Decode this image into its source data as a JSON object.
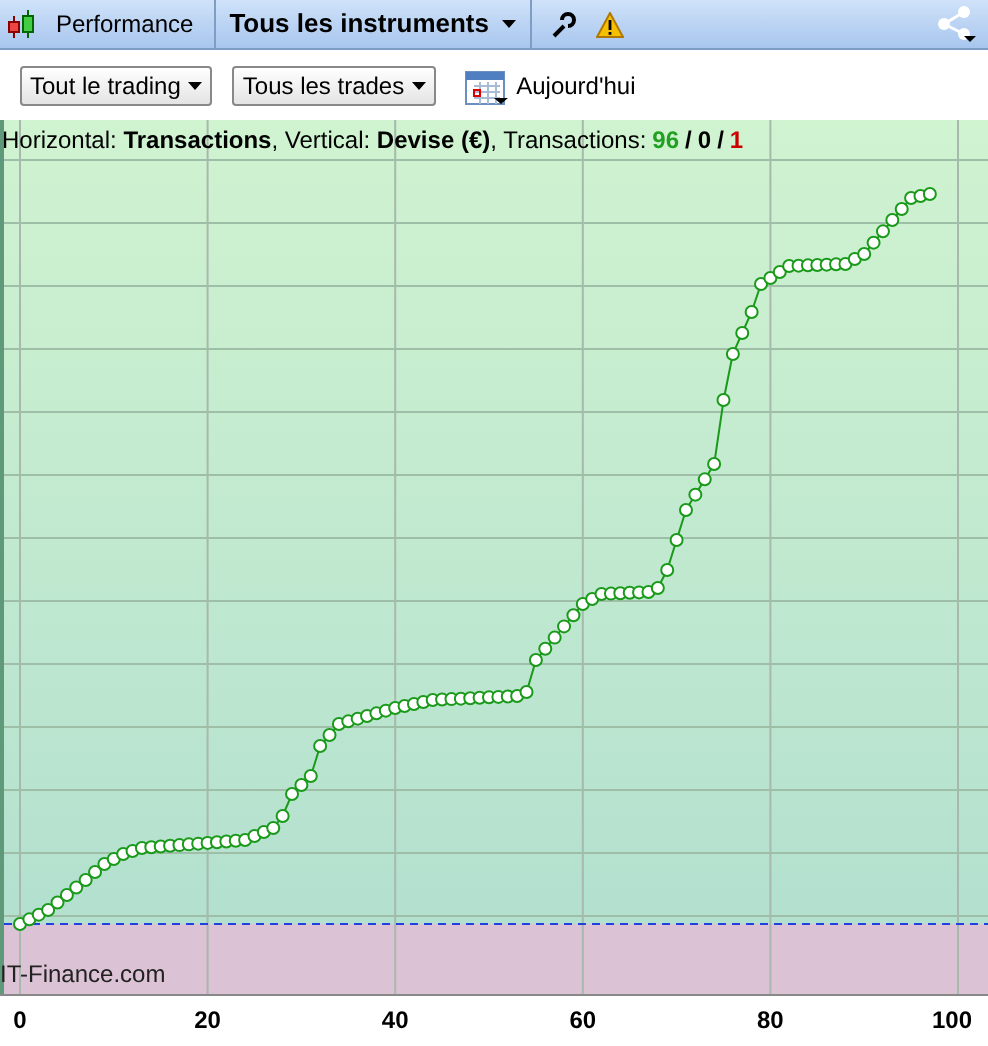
{
  "toolbar": {
    "title": "Performance",
    "instrument_menu": "Tous les instruments"
  },
  "filters": [
    {
      "label": "Tout le trading"
    },
    {
      "label": "Tous les trades"
    }
  ],
  "date_button": "Aujourd'hui",
  "chart": {
    "summary": "Horizontal: **Transactions**, Vertical: **Devise (€)**, Transactions:",
    "counts": [
      {
        "value": "96",
        "color": "#22a022"
      },
      {
        "value": "0",
        "color": "#000000"
      },
      {
        "value": "1",
        "color": "#cc0000"
      }
    ],
    "separators": [
      "/",
      "/"
    ],
    "credit": "IT-Finance.com",
    "xtick_labels": [
      "0",
      "20",
      "40",
      "60",
      "80",
      "100"
    ]
  }
}
